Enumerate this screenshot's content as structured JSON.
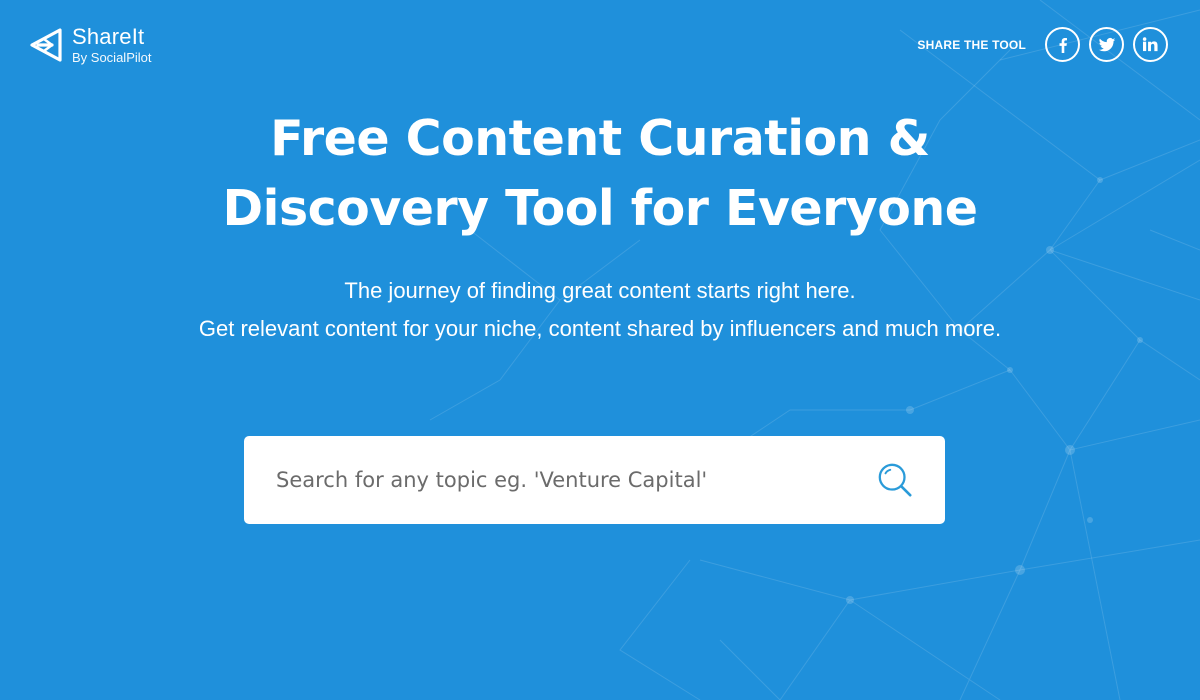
{
  "brand": {
    "name": "ShareIt",
    "byline": "By SocialPilot"
  },
  "share": {
    "label": "SHARE THE TOOL",
    "networks": [
      "facebook-icon",
      "twitter-icon",
      "linkedin-icon"
    ]
  },
  "hero": {
    "title_line1": "Free Content Curation &",
    "title_line2": "Discovery Tool for Everyone",
    "subtitle_line1": "The journey of finding great content starts right here.",
    "subtitle_line2": "Get relevant content for your niche, content shared by influencers and much more."
  },
  "search": {
    "placeholder": "Search for any topic eg. 'Venture Capital'",
    "value": "",
    "icon": "search-icon"
  },
  "colors": {
    "background": "#1f90db",
    "text": "#ffffff",
    "search_icon": "#2a9bd9"
  }
}
